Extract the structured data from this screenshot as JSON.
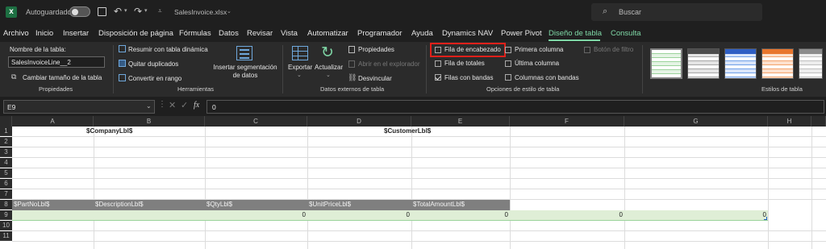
{
  "title_bar": {
    "autosave_label": "Autoguardado",
    "filename": "SalesInvoice.xlsx",
    "search_placeholder": "Buscar"
  },
  "menu": {
    "items": [
      "Archivo",
      "Inicio",
      "Insertar",
      "Disposición de página",
      "Fórmulas",
      "Datos",
      "Revisar",
      "Vista",
      "Automatizar",
      "Programador",
      "Ayuda",
      "Dynamics NAV",
      "Power Pivot",
      "Diseño de tabla",
      "Consulta"
    ],
    "active": "Diseño de tabla"
  },
  "ribbon": {
    "properties": {
      "table_name_label": "Nombre de la tabla:",
      "table_name_value": "SalesInvoiceLine__2",
      "resize_label": "Cambiar tamaño de la tabla",
      "group_label": "Propiedades"
    },
    "tools": {
      "pivot_label": "Resumir con tabla dinámica",
      "dedupe_label": "Quitar duplicados",
      "convert_label": "Convertir en rango",
      "slicer_label_1": "Insertar segmentación",
      "slicer_label_2": "de datos",
      "group_label": "Herramientas"
    },
    "external": {
      "export_label": "Exportar",
      "refresh_label": "Actualizar",
      "properties_label": "Propiedades",
      "open_browser_label": "Abrir en el explorador",
      "unlink_label": "Desvincular",
      "group_label": "Datos externos de tabla"
    },
    "style_options": {
      "header_row": "Fila de encabezado",
      "total_row": "Fila de totales",
      "banded_rows": "Filas con bandas",
      "first_column": "Primera columna",
      "last_column": "Última columna",
      "banded_columns": "Columnas con bandas",
      "filter_button": "Botón de filtro",
      "group_label": "Opciones de estilo de tabla",
      "header_row_checked": false,
      "banded_rows_checked": true
    },
    "styles": {
      "group_label": "Estilos de tabla",
      "swatch_colors": [
        "#9bd39b",
        "#a6a6a6",
        "#6f9fe8",
        "#f4a26b",
        "#bfbfbf"
      ]
    }
  },
  "formula_bar": {
    "name_box": "E9",
    "fx_label": "fx",
    "value": "0"
  },
  "sheet": {
    "columns": [
      "A",
      "B",
      "C",
      "D",
      "E",
      "F",
      "G",
      "H"
    ],
    "rows": [
      "1",
      "2",
      "3",
      "4",
      "5",
      "6",
      "7",
      "8",
      "9",
      "10",
      "11"
    ],
    "row1": {
      "company": "$CompanyLbl$",
      "customer": "$CustomerLbl$"
    },
    "header_row": [
      "$PartNoLbl$",
      "$DescriptionLbl$",
      "$QtyLbl$",
      "$UnitPriceLbl$",
      "$TotalAmountLbl$"
    ],
    "data_row": [
      "0",
      "0",
      "0",
      "0",
      "0"
    ],
    "header_fill": "#7f7f7f",
    "data_fill": "#dfeed6"
  }
}
